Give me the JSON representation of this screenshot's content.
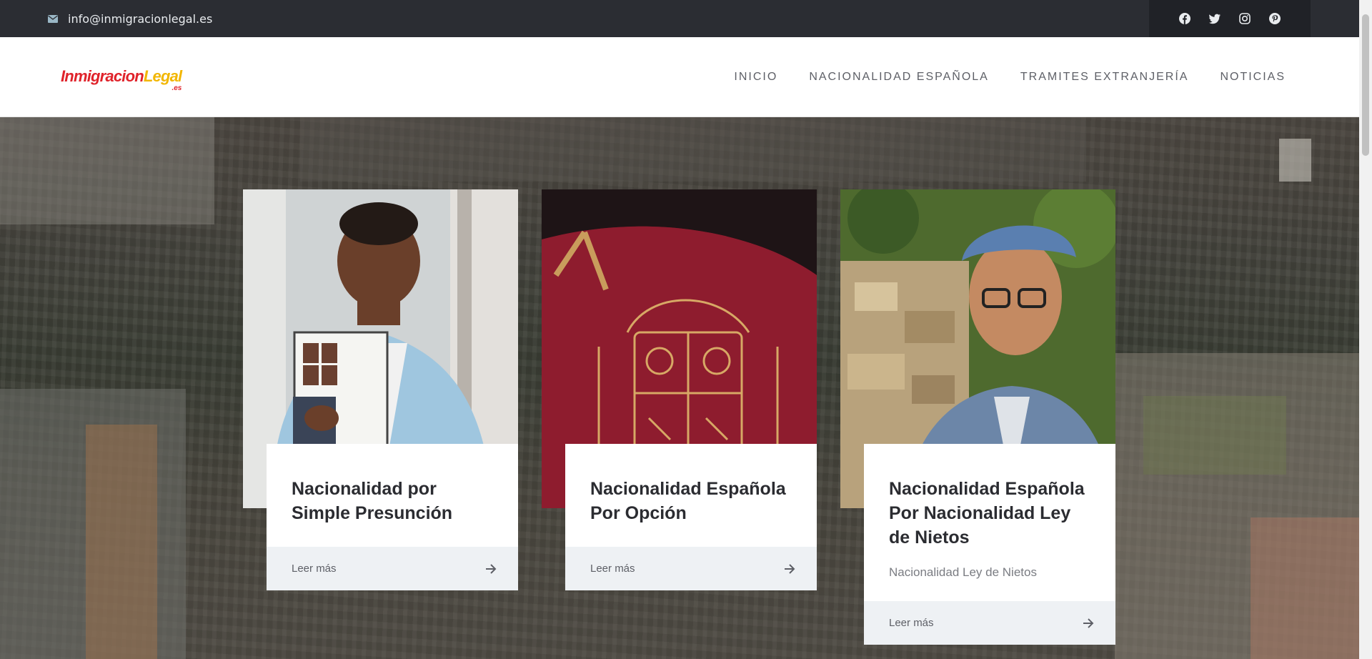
{
  "topbar": {
    "email": "info@inmigracionlegal.es",
    "email_icon": "envelope-icon",
    "social_icons": [
      "facebook-icon",
      "twitter-icon",
      "instagram-icon",
      "pinterest-icon"
    ]
  },
  "header": {
    "logo": {
      "part1": "Inmigracion",
      "part2": "Legal",
      "suffix": ".es"
    },
    "nav": [
      "INICIO",
      "NACIONALIDAD ESPAÑOLA",
      "TRAMITES EXTRANJERÍA",
      "NOTICIAS"
    ]
  },
  "cards": [
    {
      "title": "Nacionalidad por Simple Presunción",
      "excerpt": "",
      "more": "Leer más"
    },
    {
      "title": "Nacionalidad Española Por Opción",
      "excerpt": "",
      "more": "Leer más"
    },
    {
      "title": "Nacionalidad Española Por Nacionalidad Ley de Nietos",
      "excerpt": "Nacionalidad Ley de Nietos",
      "more": "Leer más"
    }
  ],
  "colors": {
    "topbar_bg": "#2b2d33",
    "logo_red": "#e0222a",
    "logo_yellow": "#f2b600",
    "card_footer_bg": "#eef1f4"
  }
}
